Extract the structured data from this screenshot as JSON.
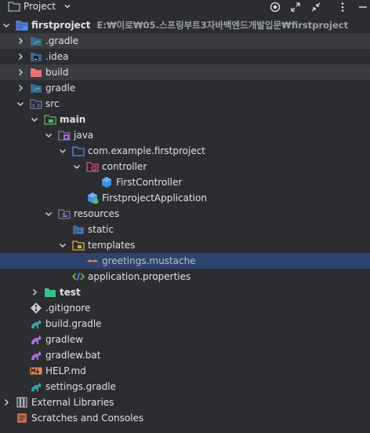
{
  "header": {
    "title": "Project",
    "icon": "folder-icon"
  },
  "tree": {
    "root": {
      "label": "firstproject",
      "path": "E:₩이로₩05.스프링부트3자바백엔드개발입문₩firstproject"
    },
    "items": [
      {
        "label": ".gradle",
        "icon": "folder-gradle-icon"
      },
      {
        "label": ".idea",
        "icon": "folder-idea-icon"
      },
      {
        "label": "build",
        "icon": "folder-excluded-icon"
      },
      {
        "label": "gradle",
        "icon": "folder-gradle-icon"
      },
      {
        "label": "src",
        "icon": "source-folder-icon"
      },
      {
        "label": "main",
        "icon": "module-folder-icon"
      },
      {
        "label": "java",
        "icon": "source-root-icon"
      },
      {
        "label": "com.example.firstproject",
        "icon": "package-icon"
      },
      {
        "label": "controller",
        "icon": "package-icon"
      },
      {
        "label": "FirstController",
        "icon": "spring-bean-icon"
      },
      {
        "label": "FirstprojectApplication",
        "icon": "spring-boot-icon"
      },
      {
        "label": "resources",
        "icon": "resources-root-icon"
      },
      {
        "label": "static",
        "icon": "web-folder-icon"
      },
      {
        "label": "templates",
        "icon": "templates-folder-icon"
      },
      {
        "label": "greetings.mustache",
        "icon": "mustache-file-icon"
      },
      {
        "label": "application.properties",
        "icon": "properties-file-icon"
      },
      {
        "label": "test",
        "icon": "test-folder-icon"
      },
      {
        "label": ".gitignore",
        "icon": "gitignore-file-icon"
      },
      {
        "label": "build.gradle",
        "icon": "gradle-file-icon"
      },
      {
        "label": "gradlew",
        "icon": "gradle-file-icon"
      },
      {
        "label": "gradlew.bat",
        "icon": "gradle-file-icon"
      },
      {
        "label": "HELP.md",
        "icon": "markdown-file-icon"
      },
      {
        "label": "settings.gradle",
        "icon": "gradle-file-icon"
      }
    ],
    "external_libraries": "External Libraries",
    "scratches": "Scratches and Consoles"
  },
  "colors": {
    "background": "#2b2d30",
    "selection": "#2e436e",
    "folder_blue": "#548af7",
    "java_green": "#5fb865",
    "gradle_teal": "#3ba2a6",
    "orange": "#e08855"
  }
}
